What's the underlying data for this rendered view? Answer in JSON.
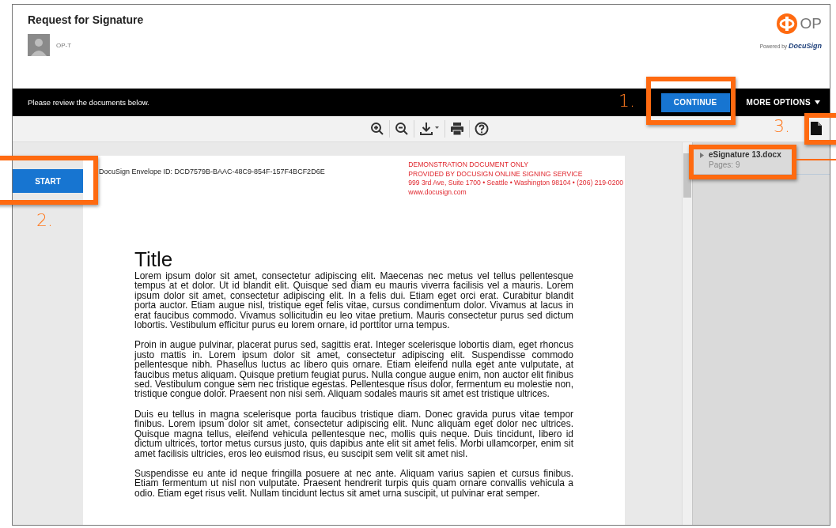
{
  "header": {
    "title": "Request for Signature",
    "sender": "OP-T",
    "brand": "OP",
    "powered_by": "Powered by",
    "powered_brand": "DocuSign"
  },
  "action_bar": {
    "message": "Please review the documents below.",
    "continue_label": "CONTINUE",
    "more_options_label": "MORE OPTIONS"
  },
  "start_button": "START",
  "document": {
    "envelope_id": "DocuSign Envelope ID: DCD7579B-BAAC-48C9-854F-157F4BCF2D6E",
    "notice_lines": [
      "DEMONSTRATION DOCUMENT ONLY",
      "PROVIDED BY DOCUSIGN ONLINE SIGNING SERVICE",
      "999 3rd Ave, Suite 1700  • Seattle • Washington 98104 • (206) 219-0200",
      "www.docusign.com"
    ],
    "title": "Title",
    "paragraphs": [
      "Lorem ipsum dolor sit amet, consectetur adipiscing elit. Maecenas nec metus vel tellus pellentesque tempus at et dolor. Ut id blandit elit. Quisque sed diam eu mauris viverra facilisis vel a mauris. Lorem ipsum dolor sit amet, consectetur adipiscing elit. In a felis dui. Etiam eget orci erat. Curabitur blandit porta auctor. Etiam augue nisl, tristique eget felis vitae, cursus condimentum dolor. Vivamus at lacus in erat faucibus commodo. Vivamus sollicitudin eu leo vitae pretium. Mauris consectetur purus sed dictum lobortis. Vestibulum efficitur purus eu lorem ornare, id porttitor urna tempus.",
      "Proin in augue pulvinar, placerat purus sed, sagittis erat. Integer scelerisque lobortis diam, eget rhoncus justo mattis in. Lorem ipsum dolor sit amet, consectetur adipiscing elit. Suspendisse commodo pellentesque nibh. Phasellus luctus ac libero quis ornare. Etiam eleifend nulla eget ante vulputate, at faucibus metus aliquam. Quisque pretium feugiat purus. Nulla congue augue enim, non auctor elit finibus sed. Vestibulum congue sem nec tristique egestas. Pellentesque risus dolor, fermentum eu molestie non, tristique congue dolor. Praesent non nisi sem. Aliquam sodales mauris sit amet est tristique ultrices.",
      "Duis eu tellus in magna scelerisque porta faucibus tristique diam. Donec gravida purus vitae tempor finibus. Lorem ipsum dolor sit amet, consectetur adipiscing elit. Nunc aliquam eget dolor nec ultrices. Quisque magna tellus, eleifend vehicula pellentesque nec, mollis quis neque. Duis tincidunt, libero id dictum ultrices, tortor metus cursus justo, quis dapibus ante elit sit amet felis. Morbi ullamcorper, enim sit amet facilisis ultricies, eros leo euismod risus, eu suscipit sem velit sit amet nisl.",
      "Suspendisse eu ante id neque fringilla posuere at nec ante. Aliquam varius sapien et cursus finibus. Etiam fermentum ut nisl non vulputate. Praesent hendrerit turpis quis quam ornare convallis vehicula a odio. Etiam eget risus velit. Nullam tincidunt lectus sit amet urna suscipit, ut pulvinar erat semper."
    ]
  },
  "documents_panel": {
    "items": [
      {
        "name": "eSignature 13.docx",
        "pages": "Pages: 9"
      }
    ]
  },
  "callouts": [
    {
      "number": "1."
    },
    {
      "number": "2."
    },
    {
      "number": "3."
    }
  ]
}
